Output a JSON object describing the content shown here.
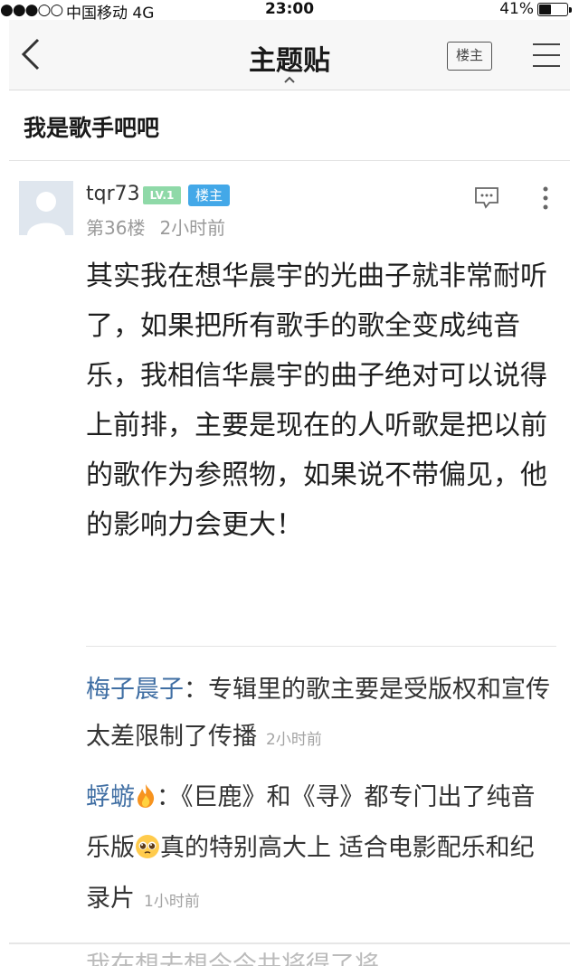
{
  "status_bar": {
    "signal": "●●●○○",
    "carrier": "中国移动  4G",
    "time": "23:00",
    "battery": "41%",
    "battery_level": 0.41
  },
  "nav": {
    "title": "主题贴",
    "op_only_label": "楼主",
    "icons": [
      "back-chevron-icon",
      "caret-up-icon",
      "menu-icon"
    ]
  },
  "thread": {
    "title": "我是歌手吧吧"
  },
  "post": {
    "username": "tqr73",
    "level": "LV.1",
    "op_badge": "楼主",
    "floor": "第36楼",
    "time_ago": "2小时前",
    "body": "其实我在想华晨宇的光曲子就非常耐听了，如果把所有歌手的歌全变成纯音乐，我相信华晨宇的曲子绝对可以说得上前排，主要是现在的人听歌是把以前的歌作为参照物，如果说不带偏见，他的影响力会更大！",
    "icons": [
      "avatar",
      "comment-icon",
      "more-vertical-icon"
    ]
  },
  "replies": [
    {
      "user": "梅子晨子",
      "separator": "：",
      "text": "专辑里的歌主要是受版权和宣传太差限制了传播",
      "time": "2小时前"
    },
    {
      "user": "蜉蝣",
      "separator": "：",
      "text_before_emoji": "《巨鹿》和《寻》都专门出了纯音乐版",
      "text_after_emoji": "真的特别高大上 适合电影配乐和纪录片",
      "time": "1小时前",
      "icons": [
        "fire-emoji-icon",
        "pleading-face-emoji-icon"
      ]
    }
  ],
  "partial_reply": "我在想去想今今共将得了将"
}
